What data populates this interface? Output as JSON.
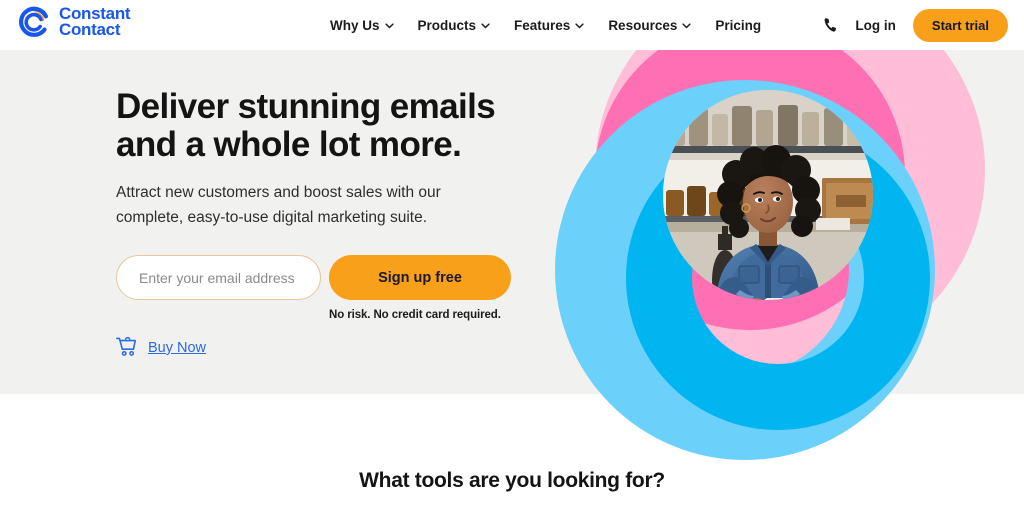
{
  "brand": {
    "name_line1": "Constant",
    "name_line2": "Contact",
    "logo_icon": "constant-contact-swirl-logo",
    "blue": "#1856ED",
    "orange": "#F9A01B"
  },
  "header": {
    "nav_items": [
      {
        "label": "Why Us",
        "has_dropdown": true,
        "icon": "chevron-down-icon"
      },
      {
        "label": "Products",
        "has_dropdown": true,
        "icon": "chevron-down-icon"
      },
      {
        "label": "Features",
        "has_dropdown": true,
        "icon": "chevron-down-icon"
      },
      {
        "label": "Resources",
        "has_dropdown": true,
        "icon": "chevron-down-icon"
      },
      {
        "label": "Pricing",
        "has_dropdown": false,
        "icon": ""
      }
    ],
    "phone_icon": "phone-icon",
    "login_label": "Log in",
    "trial_button_label": "Start trial"
  },
  "hero": {
    "title_line1": "Deliver stunning emails",
    "title_line2": "and a whole lot more.",
    "subtitle_line1": "Attract new customers and boost sales with our",
    "subtitle_line2": "complete, easy-to-use digital marketing suite.",
    "email_placeholder": "Enter your email address",
    "email_value": "",
    "signup_button_label": "Sign up free",
    "disclaimer": "No risk. No credit card required.",
    "buy_now_label": "Buy Now",
    "cart_icon": "shopping-cart-icon",
    "background_color": "#F1F1F0",
    "graphic": {
      "alt": "Woman in denim shirt holding a mug at a shop counter, framed in overlapping pink and blue circle rings",
      "pink_light": "#FFBDD8",
      "pink_bright": "#FF6FB3",
      "blue_light": "#6BD0FA",
      "blue_bright": "#00B5F0"
    }
  },
  "tools_section": {
    "heading": "What tools are you looking for?"
  }
}
